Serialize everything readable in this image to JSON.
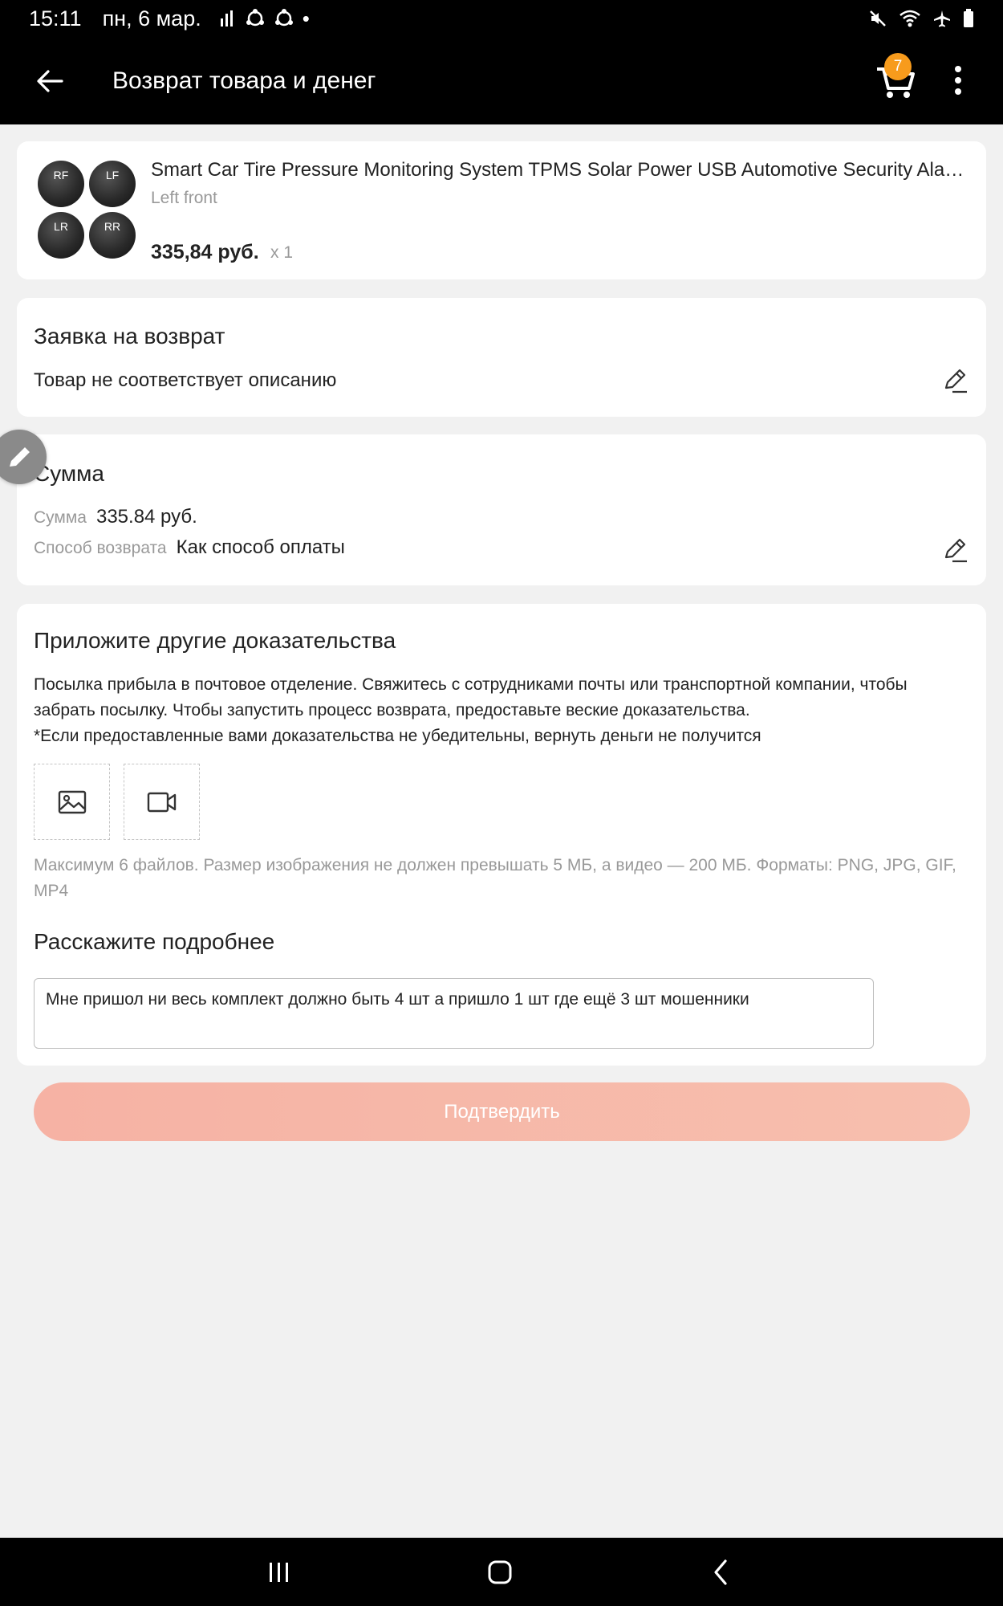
{
  "status_bar": {
    "time": "15:11",
    "date": "пн, 6 мар."
  },
  "app_bar": {
    "title": "Возврат товара и денег",
    "cart_badge": "7"
  },
  "product": {
    "name": "Smart Car Tire Pressure Monitoring System TPMS Solar Power USB Automotive Security Alarm Systems Tyre Pressure Display",
    "variant": "Left front",
    "price": "335,84 руб.",
    "quantity": "x 1",
    "sensor_labels": [
      "RF",
      "LF",
      "LR",
      "RR"
    ]
  },
  "return_request": {
    "title": "Заявка на возврат",
    "reason": "Товар не соответствует описанию"
  },
  "amount": {
    "title": "Сумма",
    "sum_label": "Сумма",
    "sum_value": "335.84 руб.",
    "method_label": "Способ возврата",
    "method_value": "Как способ оплаты"
  },
  "evidence": {
    "title": "Приложите другие доказательства",
    "description_line1": "Посылка прибыла в почтовое отделение. Свяжитесь с сотрудниками почты или транспортной компании, чтобы забрать посылку. Чтобы запустить процесс возврата, предоставьте веские доказательства.",
    "description_line2": "*Если предоставленные вами доказательства не убедительны, вернуть деньги не получится",
    "limits": "Максимум 6 файлов. Размер изображения не должен превышать 5 МБ, а видео — 200 МБ. Форматы: PNG, JPG, GIF, MP4",
    "details_title": "Расскажите подробнее",
    "details_value": "Мне пришол ни весь комплект должно быть 4 шт а пришло 1 шт где ещё 3 шт мошенники"
  },
  "submit_label": "Подтвердить",
  "colors": {
    "accent": "#f79b1c",
    "submit_disabled": "#f6b5a6"
  }
}
